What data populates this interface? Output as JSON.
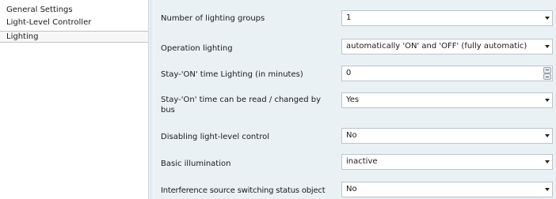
{
  "sidebar": {
    "items": [
      {
        "label": "General Settings"
      },
      {
        "label": "Light-Level Controller"
      },
      {
        "label": "Lighting",
        "selected": true
      }
    ]
  },
  "parameters": [
    {
      "label": "Number of lighting groups",
      "value": "1",
      "control": "dropdown"
    },
    {
      "label": "Operation lighting",
      "value": "automatically 'ON' and 'OFF' (fully automatic)",
      "control": "dropdown"
    },
    {
      "label": "Stay-'ON' time Lighting (in minutes)",
      "value": "0",
      "control": "spinner"
    },
    {
      "label": "Stay-'On' time can be read / changed by bus",
      "value": "Yes",
      "control": "dropdown"
    },
    {
      "label": "Disabling light-level control",
      "value": "No",
      "control": "dropdown"
    },
    {
      "label": "Basic illumination",
      "value": "inactive",
      "control": "dropdown"
    },
    {
      "label": "Interference source switching status object",
      "value": "No",
      "control": "dropdown"
    }
  ]
}
